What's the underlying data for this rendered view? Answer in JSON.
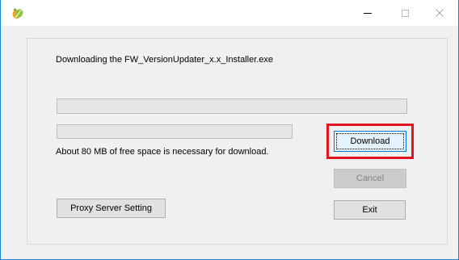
{
  "window": {
    "minimize_label": "–",
    "maximize_label": "□",
    "close_label": "×",
    "app_icon": "leaf-app-icon"
  },
  "status": {
    "message": "Downloading the FW_VersionUpdater_x.x_Installer.exe",
    "total_progress": 0,
    "file_progress": 0,
    "free_space_note": "About 80 MB of free space is necessary for download."
  },
  "buttons": {
    "download": "Download",
    "cancel": "Cancel",
    "exit": "Exit",
    "proxy": "Proxy Server Setting"
  },
  "colors": {
    "highlight": "#e2141f",
    "focus_border": "#0078d7",
    "window_border": "#1883d7",
    "progress_fill": "#06b025"
  }
}
